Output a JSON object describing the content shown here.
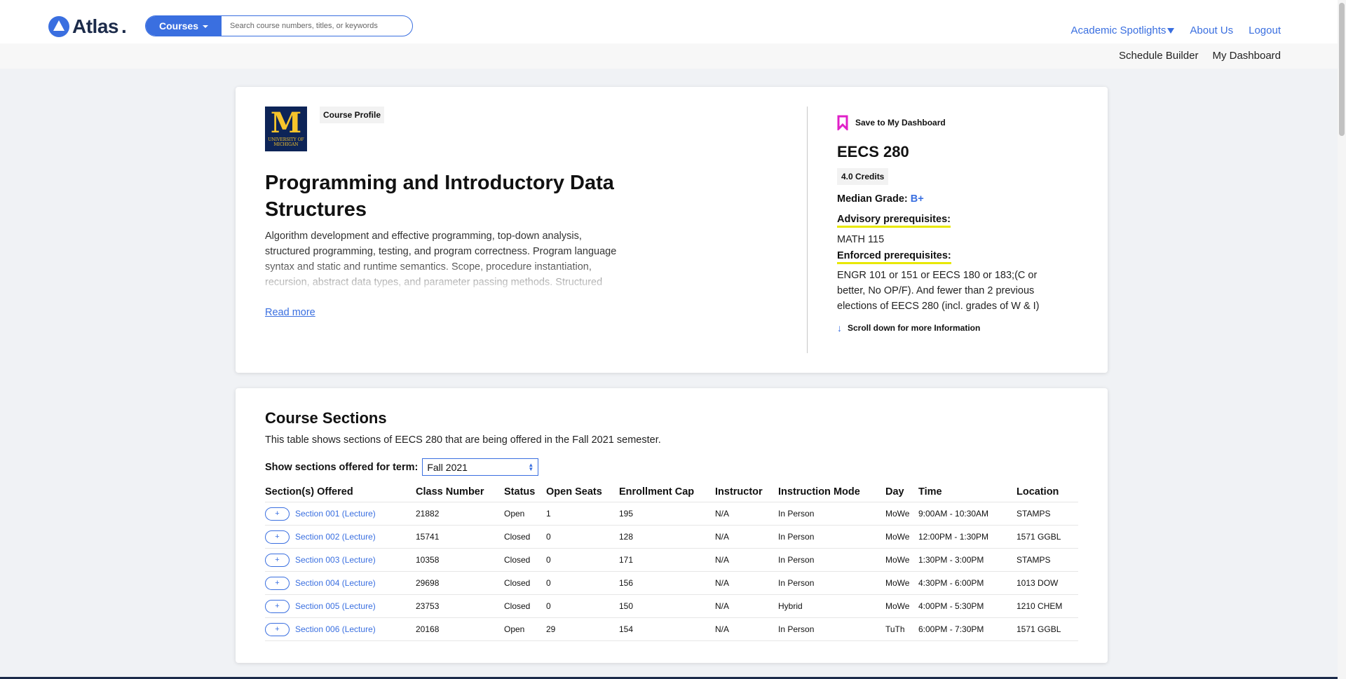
{
  "header": {
    "logo_text": "Atlas",
    "search": {
      "courses_label": "Courses",
      "placeholder": "Search course numbers, titles, or keywords"
    },
    "nav": {
      "spotlights": "Academic Spotlights",
      "about": "About Us",
      "logout": "Logout"
    },
    "subnav": {
      "schedule_builder": "Schedule Builder",
      "dashboard": "My Dashboard"
    }
  },
  "profile": {
    "tag": "Course Profile",
    "logo_sub": "UNIVERSITY OF MICHIGAN",
    "title": "Programming and Introductory Data Structures",
    "description": "Algorithm development and effective programming, top-down analysis, structured programming, testing, and program correctness. Program language syntax and static and runtime semantics. Scope, procedure instantiation, recursion, abstract data types, and parameter passing methods. Structured",
    "read_more": "Read more",
    "save_label": "Save to My Dashboard",
    "code": "EECS 280",
    "credits": "4.0 Credits",
    "median_label": "Median Grade:",
    "median_grade": "B+",
    "advisory_label": "Advisory prerequisites:",
    "advisory_value": "MATH 115",
    "enforced_label": "Enforced prerequisites:",
    "enforced_value": "ENGR 101 or 151 or EECS 180 or 183;(C or better, No OP/F). And fewer than 2 previous elections of EECS 280 (incl. grades of W & I)",
    "scroll_hint": "Scroll down for more Information"
  },
  "sections": {
    "title": "Course Sections",
    "description": "This table shows sections of EECS 280 that are being offered in the Fall 2021 semester.",
    "term_label": "Show sections offered for term:",
    "term_value": "Fall 2021",
    "columns": [
      "Section(s) Offered",
      "Class Number",
      "Status",
      "Open Seats",
      "Enrollment Cap",
      "Instructor",
      "Instruction Mode",
      "Day",
      "Time",
      "Location"
    ],
    "rows": [
      {
        "section": "Section 001 (Lecture)",
        "class_number": "21882",
        "status": "Open",
        "open_seats": "1",
        "cap": "195",
        "instructor": "N/A",
        "mode": "In Person",
        "day": "MoWe",
        "time": "9:00AM - 10:30AM",
        "location": "STAMPS"
      },
      {
        "section": "Section 002 (Lecture)",
        "class_number": "15741",
        "status": "Closed",
        "open_seats": "0",
        "cap": "128",
        "instructor": "N/A",
        "mode": "In Person",
        "day": "MoWe",
        "time": "12:00PM - 1:30PM",
        "location": "1571 GGBL"
      },
      {
        "section": "Section 003 (Lecture)",
        "class_number": "10358",
        "status": "Closed",
        "open_seats": "0",
        "cap": "171",
        "instructor": "N/A",
        "mode": "In Person",
        "day": "MoWe",
        "time": "1:30PM - 3:00PM",
        "location": "STAMPS"
      },
      {
        "section": "Section 004 (Lecture)",
        "class_number": "29698",
        "status": "Closed",
        "open_seats": "0",
        "cap": "156",
        "instructor": "N/A",
        "mode": "In Person",
        "day": "MoWe",
        "time": "4:30PM - 6:00PM",
        "location": "1013 DOW"
      },
      {
        "section": "Section 005 (Lecture)",
        "class_number": "23753",
        "status": "Closed",
        "open_seats": "0",
        "cap": "150",
        "instructor": "N/A",
        "mode": "Hybrid",
        "day": "MoWe",
        "time": "4:00PM - 5:30PM",
        "location": "1210 CHEM"
      },
      {
        "section": "Section 006 (Lecture)",
        "class_number": "20168",
        "status": "Open",
        "open_seats": "29",
        "cap": "154",
        "instructor": "N/A",
        "mode": "In Person",
        "day": "TuTh",
        "time": "6:00PM - 7:30PM",
        "location": "1571 GGBL"
      }
    ]
  },
  "colors": {
    "accent": "#3a6fe0",
    "bookmark": "#e020c8",
    "highlight": "#e8e800",
    "navy": "#1c2b4a",
    "michigan_blue": "#0d2457",
    "michigan_maize": "#f6c42b"
  },
  "icons": {
    "bookmark": "bookmark-icon",
    "arrow": "arrow-down-icon",
    "plus": "plus-icon",
    "caret": "chevron-down-icon"
  }
}
